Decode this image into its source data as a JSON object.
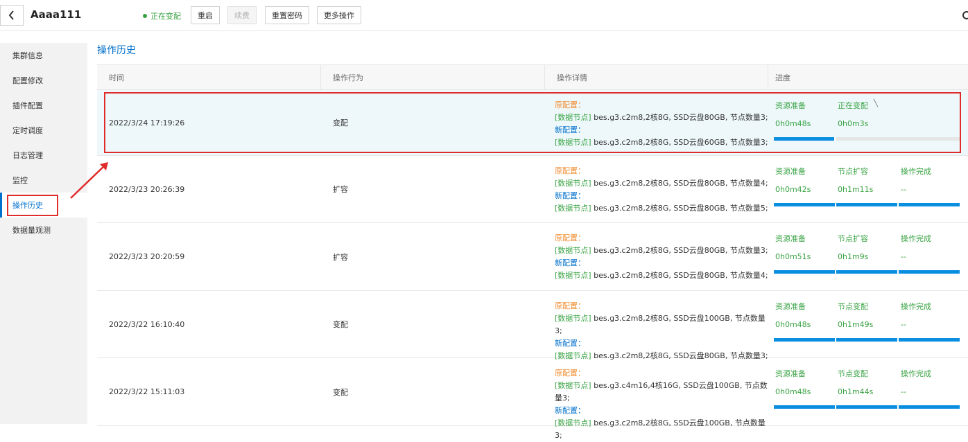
{
  "header": {
    "title": "Aaaa111",
    "status": "正在变配",
    "buttons": {
      "restart": "重启",
      "renew": "续费",
      "reset_password": "重置密码",
      "more": "更多操作"
    }
  },
  "sidebar": {
    "items": [
      {
        "label": "集群信息"
      },
      {
        "label": "配置修改"
      },
      {
        "label": "插件配置"
      },
      {
        "label": "定时调度"
      },
      {
        "label": "日志管理"
      },
      {
        "label": "监控"
      },
      {
        "label": "操作历史",
        "active": true
      },
      {
        "label": "数据量观测"
      }
    ]
  },
  "main": {
    "title": "操作历史",
    "columns": [
      "时间",
      "操作行为",
      "操作详情",
      "进度"
    ],
    "labels": {
      "orig": "原配置：",
      "new": "新配置：",
      "node_tag": "[数据节点]"
    },
    "rows": [
      {
        "time": "2022/3/24 17:19:26",
        "action": "变配",
        "orig": "bes.g3.c2m8,2核8G, SSD云盘80GB, 节点数量3;",
        "new": "bes.g3.c2m8,2核8G, SSD云盘60GB, 节点数量3;",
        "steps": [
          {
            "label": "资源准备",
            "time": "0h0m48s"
          },
          {
            "label": "正在变配",
            "time": "0h0m3s"
          }
        ],
        "progress_fraction": 0.33,
        "highlight": true
      },
      {
        "time": "2022/3/23 20:26:39",
        "action": "扩容",
        "orig": "bes.g3.c2m8,2核8G, SSD云盘80GB, 节点数量4;",
        "new": "bes.g3.c2m8,2核8G, SSD云盘80GB, 节点数量5;",
        "steps": [
          {
            "label": "资源准备",
            "time": "0h0m42s"
          },
          {
            "label": "节点扩容",
            "time": "0h1m11s"
          },
          {
            "label": "操作完成",
            "time": "--"
          }
        ],
        "progress_fraction": 1
      },
      {
        "time": "2022/3/23 20:20:59",
        "action": "扩容",
        "orig": "bes.g3.c2m8,2核8G, SSD云盘80GB, 节点数量3;",
        "new": "bes.g3.c2m8,2核8G, SSD云盘80GB, 节点数量4;",
        "steps": [
          {
            "label": "资源准备",
            "time": "0h0m51s"
          },
          {
            "label": "节点扩容",
            "time": "0h1m9s"
          },
          {
            "label": "操作完成",
            "time": "--"
          }
        ],
        "progress_fraction": 1
      },
      {
        "time": "2022/3/22 16:10:40",
        "action": "变配",
        "orig": "bes.g3.c2m8,2核8G, SSD云盘100GB, 节点数量3;",
        "new": "bes.g3.c2m8,2核8G, SSD云盘80GB, 节点数量3;",
        "steps": [
          {
            "label": "资源准备",
            "time": "0h0m48s"
          },
          {
            "label": "节点变配",
            "time": "0h1m49s"
          },
          {
            "label": "操作完成",
            "time": "--"
          }
        ],
        "progress_fraction": 1
      },
      {
        "time": "2022/3/22 15:11:03",
        "action": "变配",
        "orig": "bes.g3.c4m16,4核16G, SSD云盘100GB, 节点数量3;",
        "new": "bes.g3.c2m8,2核8G, SSD云盘100GB, 节点数量3;",
        "steps": [
          {
            "label": "资源准备",
            "time": "0h0m48s"
          },
          {
            "label": "节点变配",
            "time": "0h1m44s"
          },
          {
            "label": "操作完成",
            "time": "--"
          }
        ],
        "progress_fraction": 1
      }
    ]
  },
  "colors": {
    "accent": "#0070cc",
    "success": "#39a343",
    "orig_label": "#f08c2e",
    "annotation": "#e02b2b",
    "bar": "#0a8ee0"
  },
  "icons": {
    "back": "chevron-left-icon",
    "refresh": "refresh-icon",
    "status_dot": "status-dot-icon"
  }
}
